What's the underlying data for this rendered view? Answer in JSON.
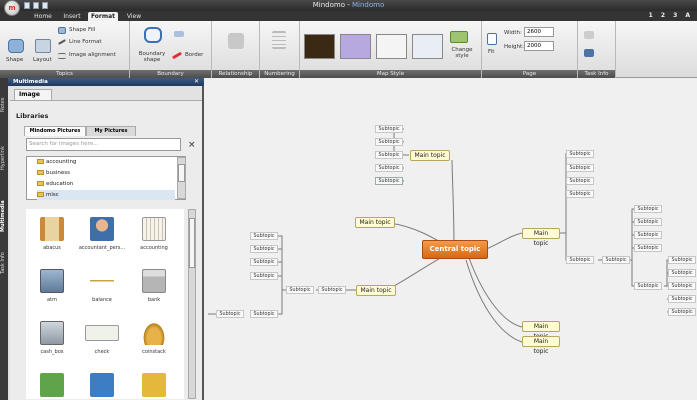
{
  "window": {
    "title_app": "Mindomo",
    "title_doc": "Mindomo",
    "tabs": [
      "Home",
      "Insert",
      "Format",
      "View"
    ],
    "active_tab": "Format",
    "page_indicator": "1 2 3 A"
  },
  "ribbon": {
    "topics": {
      "shape": "Shape",
      "layout": "Layout",
      "shape_fill": "Shape Fill",
      "line_format": "Line Format",
      "image_alignment": "Image alignment",
      "label": "Topics"
    },
    "boundary": {
      "boundary_shape": "Boundary shape",
      "border": "Border",
      "label": "Boundary"
    },
    "relationship": {
      "label": "Relationship"
    },
    "numbering": {
      "label": "Numbering"
    },
    "map_style": {
      "change_style": "Change style",
      "label": "Map Style"
    },
    "page": {
      "fit": "Fit",
      "width_label": "Width:",
      "width_value": "2600",
      "height_label": "Height:",
      "height_value": "2000",
      "label": "Page"
    },
    "task_info": {
      "label": "Task Info"
    }
  },
  "side_tabs": [
    "Notes",
    "Hyperlink",
    "Multimedia",
    "Task Info"
  ],
  "panel": {
    "header": "Multimedia",
    "tab": "Image",
    "libraries_title": "Libraries",
    "subtabs": [
      "Mindomo Pictures",
      "My Pictures"
    ],
    "search_placeholder": "Search for images here...",
    "folders": [
      "accounting",
      "business",
      "education",
      "misc"
    ],
    "thumbnails": [
      "abacus",
      "accountant_pers...",
      "accounting",
      "atm",
      "balance",
      "bank",
      "cash_box",
      "check",
      "coinstack"
    ]
  },
  "mindmap": {
    "central": "Central topic",
    "main": [
      "Main topic",
      "Main topic",
      "Main topic",
      "Main topic",
      "Main topic",
      "Main topic"
    ],
    "subtopic_label": "Subtopic"
  },
  "colors": {
    "accent": "#f07a1f",
    "main_topic_fill": "#fffbd3",
    "panel_header": "#2c4a70"
  }
}
